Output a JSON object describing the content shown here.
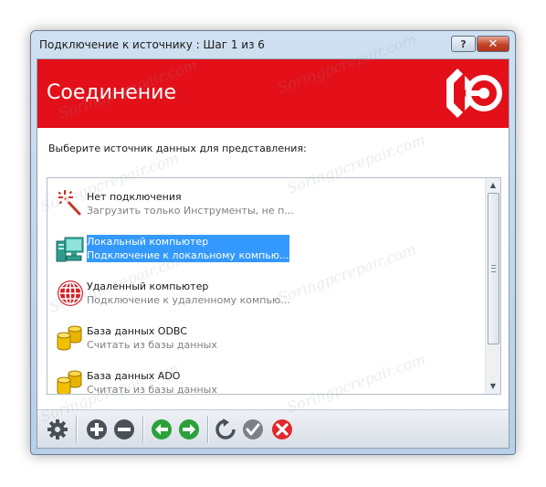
{
  "window": {
    "title": "Подключение к источнику : Шаг 1 из 6",
    "help_glyph": "?",
    "close_glyph": "✕"
  },
  "banner": {
    "title": "Соединение",
    "color": "#e3101a"
  },
  "prompt": "Выберите источник данных для представления:",
  "sources": [
    {
      "title": "Нет подключения",
      "subtitle": "Загрузить только Инструменты, не п...",
      "icon": "magic-wand-icon",
      "selected": false
    },
    {
      "title": "Локальный компьютер",
      "subtitle": "Подключение к локальному компью...",
      "icon": "local-computer-icon",
      "selected": true
    },
    {
      "title": "Удаленный компьютер",
      "subtitle": "Подключение к удаленному компью...",
      "icon": "globe-icon",
      "selected": false
    },
    {
      "title": "База данных ODBC",
      "subtitle": "Считать из базы данных",
      "icon": "database-icon",
      "selected": false
    },
    {
      "title": "База данных ADO",
      "subtitle": "Считать из базы данных",
      "icon": "database-icon",
      "selected": false
    }
  ],
  "toolbar": [
    "settings-gear-icon",
    "add-icon",
    "remove-icon",
    "back-arrow-icon",
    "forward-arrow-icon",
    "refresh-icon",
    "ok-check-icon",
    "cancel-icon"
  ],
  "watermark": "Soringpcrepair.com",
  "colors": {
    "selection": "#3399ff",
    "nav_green": "#2aa13a",
    "cancel_red": "#e0282e"
  }
}
